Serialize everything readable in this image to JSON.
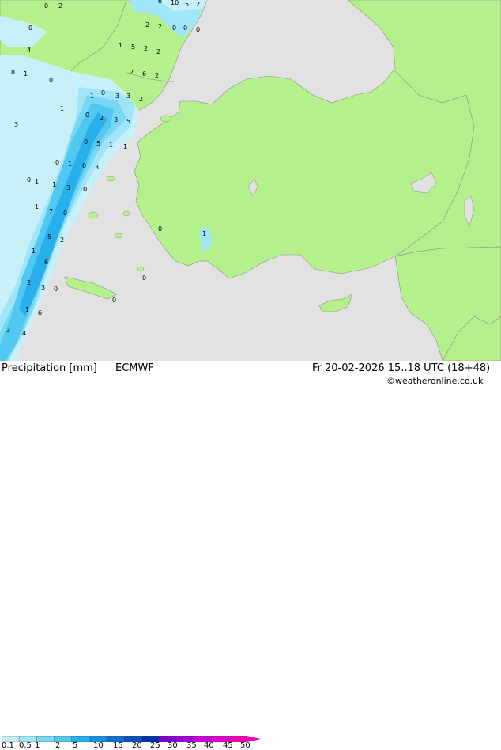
{
  "title": "Precipitation [mm]",
  "model": "ECMWF",
  "datetime": "Fr 20-02-2026 15..18 UTC (18+48)",
  "credit": "©weatheronline.co.uk",
  "legend_ticks": [
    "0.1",
    "0.5",
    "1",
    "2",
    "5",
    "10",
    "15",
    "20",
    "25",
    "30",
    "35",
    "40",
    "45",
    "50"
  ],
  "legend_colors": [
    "#c8f0f8",
    "#a0e6f8",
    "#78d8f4",
    "#50c8f0",
    "#28b0ec",
    "#1890e0",
    "#1070d0",
    "#0850c0",
    "#0030a8",
    "#8000d0",
    "#a000e0",
    "#c800e0",
    "#e000d0",
    "#f000b0"
  ],
  "colors": {
    "sea": "#e2e2e2",
    "land": "#b4f08c",
    "border": "#8a8a8a"
  },
  "precip_values": [
    "0",
    "2",
    "6",
    "10",
    "5",
    "2",
    "2",
    "2",
    "0",
    "0",
    "0",
    "0",
    "4",
    "8",
    "1",
    "0",
    "1",
    "5",
    "2",
    "2",
    "2",
    "6",
    "2",
    "0",
    "1",
    "3",
    "3",
    "2",
    "1",
    "0",
    "2",
    "3",
    "5",
    "3",
    "0",
    "5",
    "1",
    "1",
    "0",
    "1",
    "0",
    "3",
    "1",
    "3",
    "10",
    "1",
    "0",
    "1",
    "7",
    "0",
    "5",
    "2",
    "1",
    "2",
    "6",
    "3",
    "0",
    "1",
    "6",
    "3",
    "4",
    "0",
    "1",
    "0",
    "0"
  ]
}
